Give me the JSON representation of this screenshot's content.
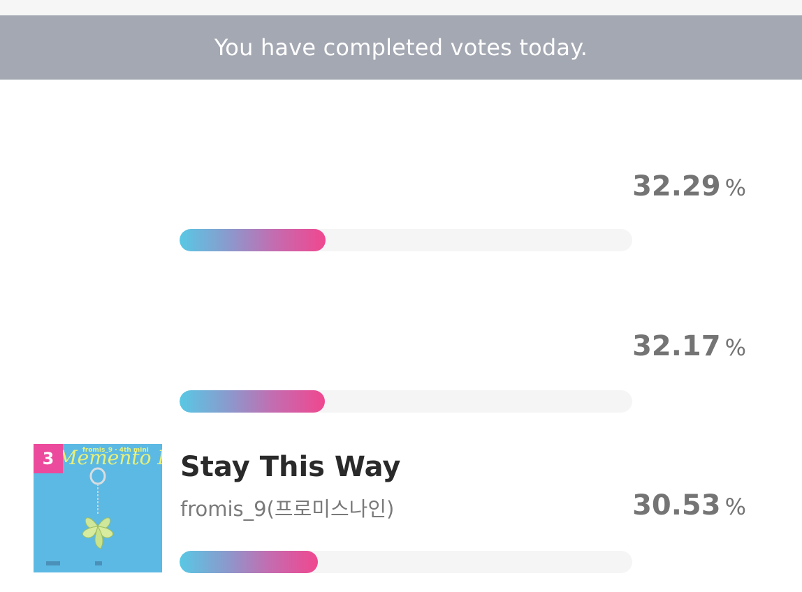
{
  "banner": {
    "text": "You have completed votes today."
  },
  "entries": [
    {
      "percent": "32.29",
      "unit": "%",
      "bar_fraction": 0.3229
    },
    {
      "percent": "32.17",
      "unit": "%",
      "bar_fraction": 0.3217
    },
    {
      "rank": "3",
      "title": "Stay This Way",
      "artist": "fromis_9(프로미스나인)",
      "album_cover_text": "Memento Box",
      "album_cover_small_text": "fromis_9 ∙ 4th mini",
      "percent": "30.53",
      "unit": "%",
      "bar_fraction": 0.3053
    }
  ],
  "colors": {
    "banner_bg": "#a4a8b2",
    "rank_badge": "#ec4a9c",
    "bar_start": "#58c8e4",
    "bar_end": "#f0478f"
  }
}
